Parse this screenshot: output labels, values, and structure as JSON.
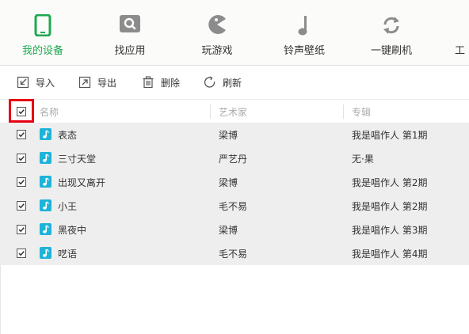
{
  "nav": {
    "items": [
      {
        "label": "我的设备",
        "icon": "phone-icon",
        "active": true
      },
      {
        "label": "找应用",
        "icon": "app-search-icon",
        "active": false
      },
      {
        "label": "玩游戏",
        "icon": "game-icon",
        "active": false
      },
      {
        "label": "铃声壁纸",
        "icon": "music-note-icon",
        "active": false
      },
      {
        "label": "一键刷机",
        "icon": "refresh-icon",
        "active": false
      },
      {
        "label": "工",
        "icon": "",
        "active": false
      }
    ],
    "accent_color": "#1fa84f",
    "icon_color": "#8c8c8c"
  },
  "toolbar": {
    "import_label": "导入",
    "export_label": "导出",
    "delete_label": "删除",
    "refresh_label": "刷新"
  },
  "table": {
    "columns": [
      "名称",
      "艺术家",
      "专辑"
    ],
    "rows": [
      {
        "name": "表态",
        "artist": "梁博",
        "album": "我是唱作人 第1期",
        "checked": true
      },
      {
        "name": "三寸天堂",
        "artist": "严艺丹",
        "album": "无·果",
        "checked": true
      },
      {
        "name": "出现又离开",
        "artist": "梁博",
        "album": "我是唱作人 第2期",
        "checked": true
      },
      {
        "name": "小王",
        "artist": "毛不易",
        "album": "我是唱作人 第2期",
        "checked": true
      },
      {
        "name": "黑夜中",
        "artist": "梁博",
        "album": "我是唱作人 第3期",
        "checked": true
      },
      {
        "name": "呓语",
        "artist": "毛不易",
        "album": "我是唱作人 第4期",
        "checked": true
      }
    ],
    "select_all_checked": true,
    "highlight_color": "#e60012",
    "music_icon_color": "#1eb3d9"
  }
}
